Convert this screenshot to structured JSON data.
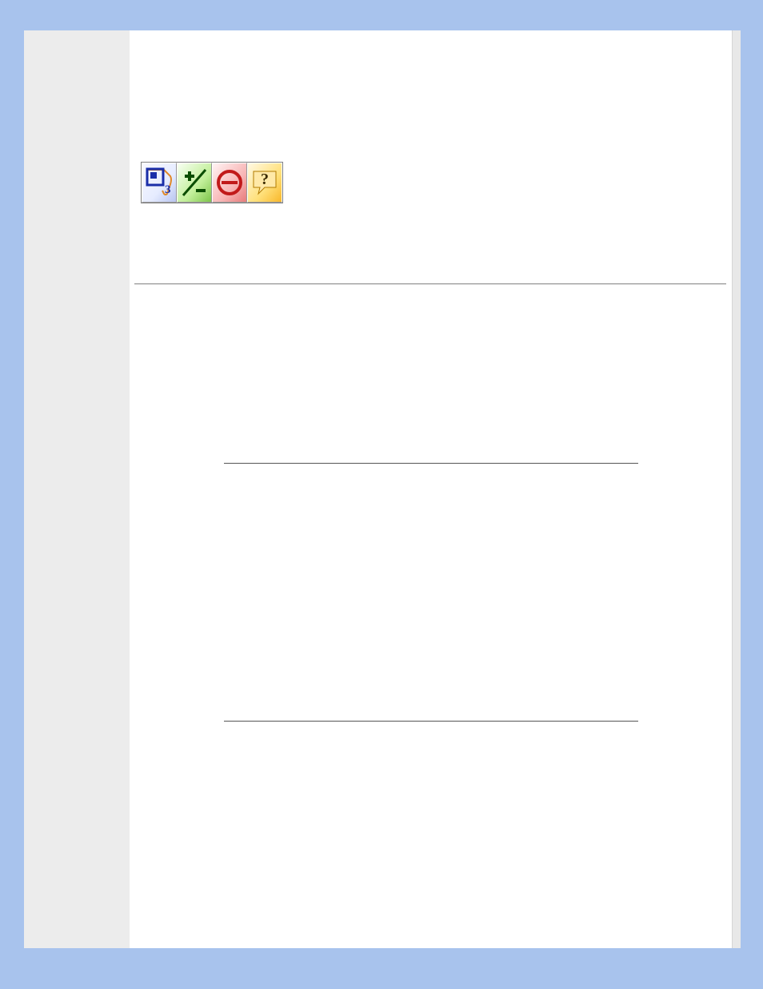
{
  "colors": {
    "page_bg": "#a8c3ed",
    "sidebar_bg": "#ececec",
    "content_bg": "#ffffff",
    "rule": "#808080"
  },
  "toolbar": {
    "buttons": [
      {
        "name": "layout-icon",
        "badge": "3",
        "bg": "blue"
      },
      {
        "name": "plus-minus-icon",
        "badge": "",
        "bg": "green"
      },
      {
        "name": "no-entry-icon",
        "badge": "",
        "bg": "red"
      },
      {
        "name": "help-icon",
        "badge": "?",
        "bg": "yellow"
      }
    ]
  }
}
